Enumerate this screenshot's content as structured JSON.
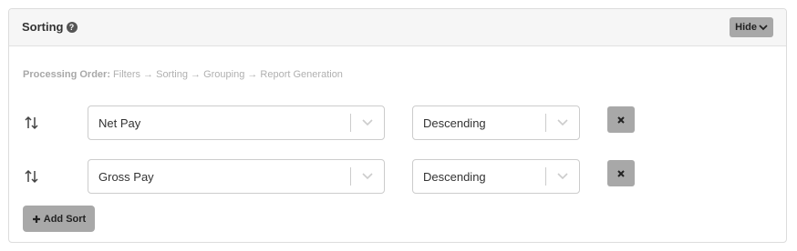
{
  "header": {
    "title": "Sorting",
    "help_icon": "question-circle-icon",
    "hide_label": "Hide"
  },
  "processing": {
    "label": "Processing Order:",
    "steps": "Filters → Sorting → Grouping → Report Generation"
  },
  "sorts": [
    {
      "field": "Net Pay",
      "direction": "Descending"
    },
    {
      "field": "Gross Pay",
      "direction": "Descending"
    }
  ],
  "add_sort_label": "Add Sort",
  "icons": {
    "remove": "close-icon",
    "handle": "sort-arrows-icon",
    "chevron": "chevron-down-icon",
    "plus": "plus-icon"
  },
  "colors": {
    "button_bg": "#a8a8a8",
    "header_bg": "#f6f6f6"
  }
}
